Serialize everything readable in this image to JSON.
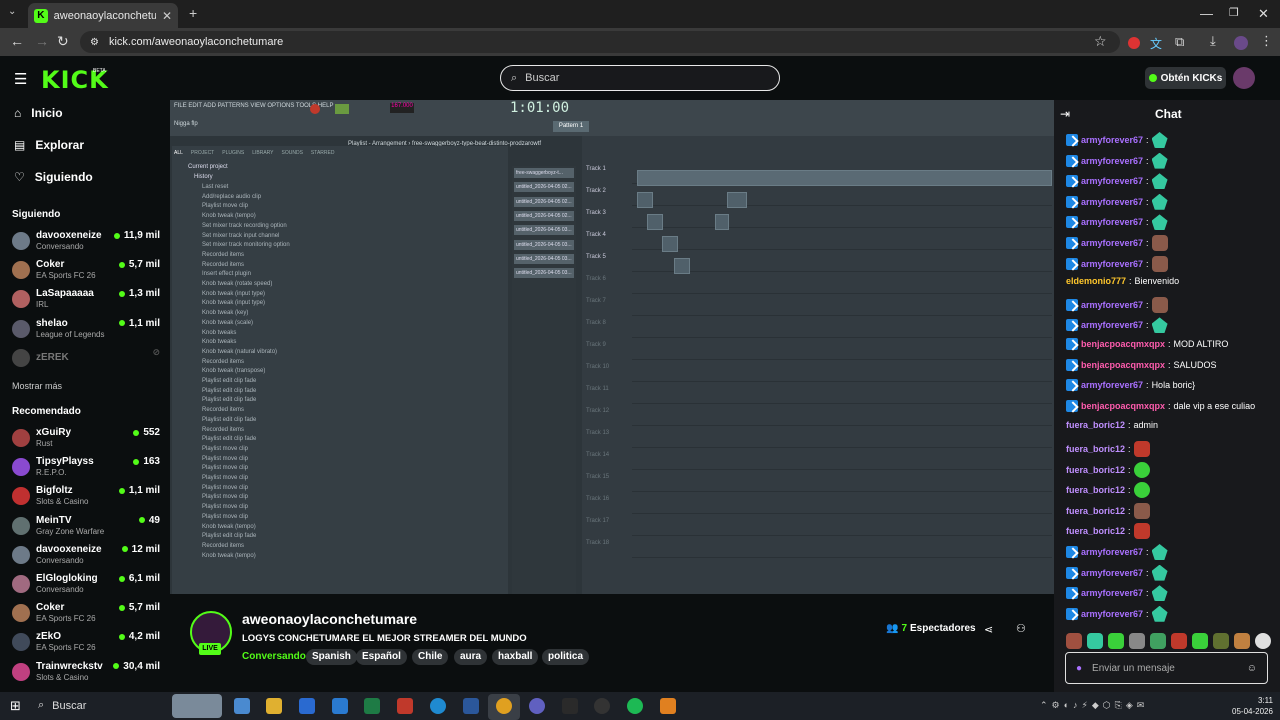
{
  "browser": {
    "tab_title": "aweonaoylaconchetumare Stre",
    "url": "kick.com/aweonaoylaconchetumare"
  },
  "header": {
    "logo": "KICK",
    "beta": "BETA",
    "search_placeholder": "Buscar",
    "kicks_label": "Obtén KICKs"
  },
  "nav": [
    {
      "label": "Inicio",
      "icon": "home-icon"
    },
    {
      "label": "Explorar",
      "icon": "compass-icon"
    },
    {
      "label": "Siguiendo",
      "icon": "heart-icon"
    }
  ],
  "following": {
    "title": "Siguiendo",
    "more": "Mostrar más",
    "channels": [
      {
        "name": "davooxeneize",
        "game": "Conversando",
        "viewers": "11,9 mil",
        "color": "#6d7a88"
      },
      {
        "name": "Coker",
        "game": "EA Sports FC 26",
        "viewers": "5,7 mil",
        "color": "#a07050"
      },
      {
        "name": "LaSapaaaaa",
        "game": "IRL",
        "viewers": "1,3 mil",
        "color": "#b06060"
      },
      {
        "name": "shelao",
        "game": "League of Legends",
        "viewers": "1,1 mil",
        "color": "#5a5a6a"
      },
      {
        "name": "zEREK",
        "game": "",
        "viewers": "",
        "color": "#444"
      }
    ]
  },
  "recommended": {
    "title": "Recomendado",
    "channels": [
      {
        "name": "xGuiRy",
        "game": "Rust",
        "viewers": "552",
        "color": "#a04040"
      },
      {
        "name": "TipsyPlayss",
        "game": "R.E.P.O.",
        "viewers": "163",
        "color": "#8a4ad0"
      },
      {
        "name": "Bigfoltz",
        "game": "Slots & Casino",
        "viewers": "1,1 mil",
        "color": "#c03030"
      },
      {
        "name": "MeinTV",
        "game": "Gray Zone Warfare",
        "viewers": "49",
        "color": "#607070"
      },
      {
        "name": "davooxeneize",
        "game": "Conversando",
        "viewers": "12 mil",
        "color": "#6d7a88"
      },
      {
        "name": "ElGlogloking",
        "game": "Conversando",
        "viewers": "6,1 mil",
        "color": "#a06a80"
      },
      {
        "name": "Coker",
        "game": "EA Sports FC 26",
        "viewers": "5,7 mil",
        "color": "#a07050"
      },
      {
        "name": "zEkO",
        "game": "EA Sports FC 26",
        "viewers": "4,2 mil",
        "color": "#404a5a"
      },
      {
        "name": "Trainwreckstv",
        "game": "Slots & Casino",
        "viewers": "30,4 mil",
        "color": "#c04080"
      }
    ]
  },
  "daw": {
    "menu": "FILE EDIT ADD PATTERNS VIEW OPTIONS TOOLS HELP",
    "tempo": "167.000",
    "time": "1:01:00",
    "pattern": "Pattern 1",
    "hint": "Nigga flp",
    "playlist_title": "Playlist - Arrangement › free-swaggerboyz-type-beat-distinto-prodzarowtf",
    "browser_tabs": [
      "ALL",
      "PROJECT",
      "PLUGINS",
      "LIBRARY",
      "SOUNDS",
      "STARRED"
    ],
    "current_project": "Current project",
    "history_label": "History",
    "history": [
      "Last reset",
      "Add/replace audio clip",
      "Playlist move clip",
      "Knob tweak (tempo)",
      "Set mixer track recording option",
      "Set mixer track input channel",
      "Set mixer track monitoring option",
      "Recorded items",
      "Recorded items",
      "Insert effect plugin",
      "Knob tweak (rotate speed)",
      "Knob tweak (input type)",
      "Knob tweak (input type)",
      "Knob tweak (key)",
      "Knob tweak (scale)",
      "Knob tweaks",
      "Knob tweaks",
      "Knob tweak (natural vibrato)",
      "Recorded items",
      "Knob tweak (transpose)",
      "Playlist edit clip fade",
      "Playlist edit clip fade",
      "Playlist edit clip fade",
      "Recorded items",
      "Playlist edit clip fade",
      "Recorded items",
      "Playlist edit clip fade",
      "Playlist move clip",
      "Playlist move clip",
      "Playlist move clip",
      "Playlist move clip",
      "Playlist move clip",
      "Playlist move clip",
      "Playlist move clip",
      "Playlist move clip",
      "Knob tweak (tempo)",
      "Playlist edit clip fade",
      "Recorded items",
      "Knob tweak (tempo)"
    ],
    "patterns": [
      "free-swaggerboyz-t...",
      "untitled_2026-04-05 02...",
      "untitled_2026-04-05 02...",
      "untitled_2026-04-05 02...",
      "untitled_2026-04-05 03...",
      "untitled_2026-04-05 03...",
      "untitled_2026-04-05 03...",
      "untitled_2026-04-05 03..."
    ],
    "tracks": [
      "Track 1",
      "Track 2",
      "Track 3",
      "Track 4",
      "Track 5",
      "Track 6",
      "Track 7",
      "Track 8",
      "Track 9",
      "Track 10",
      "Track 11",
      "Track 12",
      "Track 13",
      "Track 14",
      "Track 15",
      "Track 16",
      "Track 17",
      "Track 18"
    ]
  },
  "stream": {
    "name": "aweonaoylaconchetumare",
    "title": "LOGYS CONCHETUMARE EL MEJOR STREAMER DEL MUNDO",
    "category": "Conversando",
    "tags": [
      "Spanish",
      "Español",
      "Chile",
      "aura",
      "haxball",
      "politica"
    ],
    "viewers_count": "7",
    "viewers_label": "Espectadores",
    "live": "LIVE"
  },
  "chat": {
    "title": "Chat",
    "placeholder": "Enviar un mensaje",
    "messages": [
      {
        "user": "armyforever67",
        "text": "",
        "badge": true,
        "color": "#a970ff",
        "emote": "g"
      },
      {
        "user": "armyforever67",
        "text": "",
        "badge": true,
        "color": "#a970ff",
        "emote": "g"
      },
      {
        "user": "armyforever67",
        "text": "",
        "badge": true,
        "color": "#a970ff",
        "emote": "g"
      },
      {
        "user": "armyforever67",
        "text": "",
        "badge": true,
        "color": "#a970ff",
        "emote": "g"
      },
      {
        "user": "armyforever67",
        "text": "",
        "badge": true,
        "color": "#a970ff",
        "emote": "g"
      },
      {
        "user": "armyforever67",
        "text": "",
        "badge": true,
        "color": "#a970ff",
        "emote": "f"
      },
      {
        "user": "armyforever67",
        "text": "",
        "badge": true,
        "color": "#a970ff",
        "emote": "f"
      },
      {
        "user": "eldemonio777",
        "text": "Bienvenido",
        "badge": false,
        "color": "#ffc72c",
        "emote": ""
      },
      {
        "user": "armyforever67",
        "text": "",
        "badge": true,
        "color": "#a970ff",
        "emote": "f"
      },
      {
        "user": "armyforever67",
        "text": "",
        "badge": true,
        "color": "#a970ff",
        "emote": "g"
      },
      {
        "user": "benjacpoacqmxqpx",
        "text": "MOD ALTIRO",
        "badge": true,
        "color": "#ff5cae",
        "emote": ""
      },
      {
        "user": "benjacpoacqmxqpx",
        "text": "SALUDOS",
        "badge": true,
        "color": "#ff5cae",
        "emote": ""
      },
      {
        "user": "armyforever67",
        "text": "Hola boric}",
        "badge": true,
        "color": "#a970ff",
        "emote": ""
      },
      {
        "user": "benjacpoacqmxqpx",
        "text": "dale vip a ese culiao",
        "badge": true,
        "color": "#ff5cae",
        "emote": ""
      },
      {
        "user": "fuera_boric12",
        "text": "admin",
        "badge": false,
        "color": "#c090ff",
        "emote": ""
      },
      {
        "user": "fuera_boric12",
        "text": "",
        "badge": false,
        "color": "#c090ff",
        "emote": "r"
      },
      {
        "user": "fuera_boric12",
        "text": "",
        "badge": false,
        "color": "#c090ff",
        "emote": "gr"
      },
      {
        "user": "fuera_boric12",
        "text": "",
        "badge": false,
        "color": "#c090ff",
        "emote": "gr"
      },
      {
        "user": "fuera_boric12",
        "text": "",
        "badge": false,
        "color": "#c090ff",
        "emote": "f"
      },
      {
        "user": "fuera_boric12",
        "text": "",
        "badge": false,
        "color": "#c090ff",
        "emote": "r"
      },
      {
        "user": "armyforever67",
        "text": "",
        "badge": true,
        "color": "#a970ff",
        "emote": "g"
      },
      {
        "user": "armyforever67",
        "text": "",
        "badge": true,
        "color": "#a970ff",
        "emote": "g"
      },
      {
        "user": "armyforever67",
        "text": "",
        "badge": true,
        "color": "#a970ff",
        "emote": "g"
      },
      {
        "user": "armyforever67",
        "text": "",
        "badge": true,
        "color": "#a970ff",
        "emote": "g"
      }
    ]
  },
  "taskbar": {
    "search": "Buscar",
    "time": "3:11",
    "date": "05-04-2026"
  },
  "colors": {
    "accent": "#53fc18",
    "bg": "#0b0e0f",
    "chat_bg": "#18191c"
  }
}
